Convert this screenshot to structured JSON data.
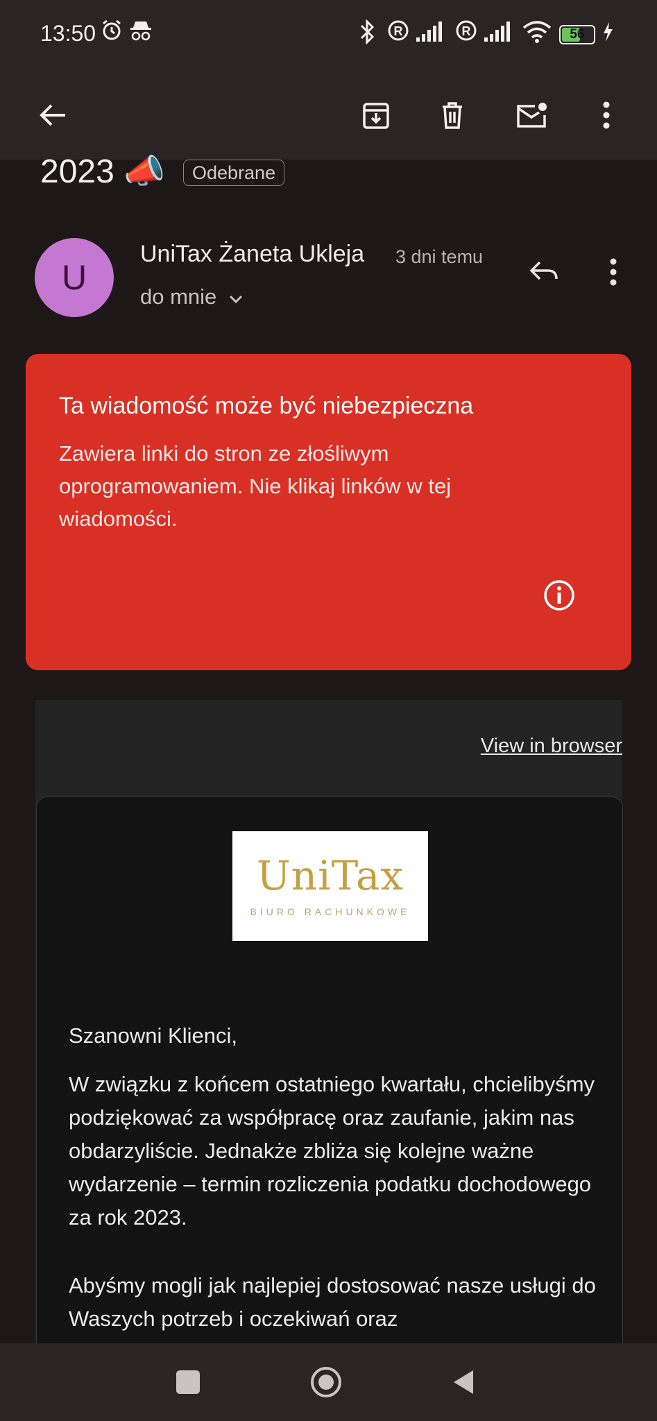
{
  "status_bar": {
    "time": "13:50",
    "battery": "56"
  },
  "app_bar": {
    "back_icon": "arrow-back-icon",
    "actions": [
      "archive-icon",
      "delete-icon",
      "mark-unread-icon",
      "more-vert-icon"
    ]
  },
  "subject": {
    "text": "2023 📣",
    "label": "Odebrane"
  },
  "sender": {
    "avatar_letter": "U",
    "avatar_color": "#c578d1",
    "name": "UniTax Żaneta Ukleja",
    "time": "3 dni temu",
    "recipient": "do mnie"
  },
  "warning": {
    "title": "Ta wiadomość może być niebezpieczna",
    "body": "Zawiera linki do stron ze złośliwym oprogramowaniem. Nie klikaj linków w tej wiadomości.",
    "color": "#d93025"
  },
  "email": {
    "view_in_browser": "View in browser",
    "logo_text": "UniTax",
    "logo_subtext": "BIURO RACHUNKOWE",
    "greeting": "Szanowni Klienci,",
    "paragraph1": "W związku z końcem ostatniego kwartału, chcielibyśmy podziękować za współpracę oraz zaufanie, jakim nas obdarzyliście. Jednakże zbliża się kolejne ważne wydarzenie – termin rozliczenia podatku dochodowego za rok 2023.",
    "paragraph2": "Abyśmy mogli jak najlepiej dostosować nasze usługi do Waszych potrzeb i oczekiwań oraz"
  }
}
